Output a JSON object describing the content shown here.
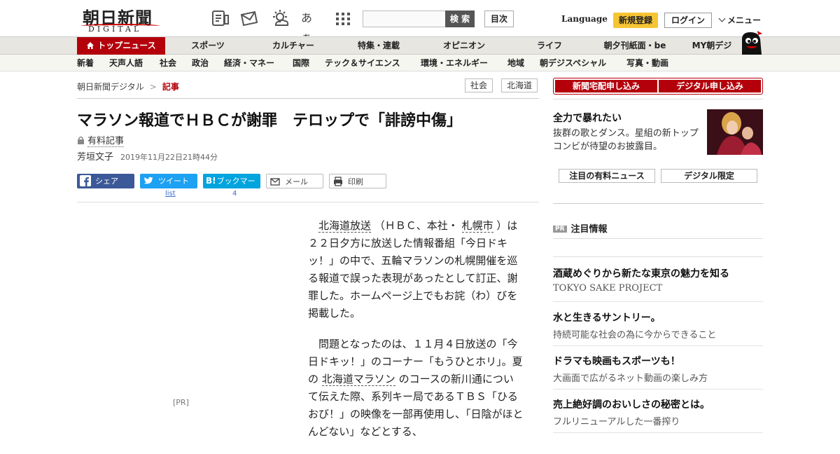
{
  "header": {
    "logo_kanji": "朝日新聞",
    "logo_sub": "DIGITAL",
    "kana_icon": "あぁ",
    "search_placeholder": "",
    "search_button": "検 索",
    "toc_button": "目次",
    "language": "Language",
    "register": "新規登録",
    "login": "ログイン",
    "menu": "メニュー"
  },
  "nav_primary": [
    "トップニュース",
    "スポーツ",
    "カルチャー",
    "特集・連載",
    "オピニオン",
    "ライフ",
    "朝夕刊紙面・be",
    "MY朝デジ"
  ],
  "nav_secondary": [
    "新着",
    "天声人語",
    "社会",
    "政治",
    "経済・マネー",
    "国際",
    "テック＆サイエンス",
    "環境・エネルギー",
    "地域",
    "朝デジスペシャル",
    "写真・動画"
  ],
  "breadcrumb": {
    "home": "朝日新聞デジタル",
    "sep": ">",
    "current": "記事"
  },
  "tags": [
    "社会",
    "北海道"
  ],
  "article": {
    "headline": "マラソン報道でＨＢＣが謝罪　テロップで「誹謗中傷」",
    "paid_label": "有料記事",
    "author": "芳垣文子",
    "date": "2019年11月22日21時44分",
    "share": {
      "facebook": "シェア",
      "twitter": "ツイート",
      "hatena": "ブックマーク",
      "mail": "メール",
      "print": "印刷"
    },
    "twitter_count": "list",
    "hatena_count": "4",
    "pr_label": "[PR]",
    "p1_link1": "北海道放送",
    "p1_mid": "（ＨＢＣ、本社・",
    "p1_link2": "札幌市",
    "p1_rest": "）は２２日夕方に放送した情報番組「今日ドキッ！」の中で、五輪マラソンの札幌開催を巡る報道で誤った表現があったとして訂正、謝罪した。ホームページ上でもお詫（わ）びを掲載した。",
    "p2_start": "問題となったのは、１１月４日放送の「今日ドキッ！」のコーナー「もうひとホリ」。夏の",
    "p2_link": "北海道マラソン",
    "p2_rest": "のコースの新川通について伝えた際、系列キー局であるＴＢＳ「ひるおび！」の映像を一部再使用し、「日陰がほとんどない」などとする、"
  },
  "sidebar": {
    "subscribe_paper": "新聞宅配申し込み",
    "subscribe_digital": "デジタル申し込み",
    "promo_title": "全力で暴れたい",
    "promo_text": "抜群の歌とダンス。星組の新トップコンビが待望のお披露目。",
    "tab_paid": "注目の有料ニュース",
    "tab_digital": "デジタル限定",
    "pr_badge": "PR",
    "pr_heading": "注目情報",
    "ads": [
      {
        "title": "酒蔵めぐりから新たな東京の魅力を知る",
        "sub": "TOKYO SAKE PROJECT"
      },
      {
        "title": "水と生きるサントリー。",
        "sub": "持続可能な社会の為に今からできること"
      },
      {
        "title": "ドラマも映画もスポーツも！",
        "sub": "大画面で広がるネット動画の楽しみ方"
      },
      {
        "title": "売上絶好調のおいしさの秘密とは。",
        "sub": "フルリニューアルした一番搾り"
      }
    ]
  },
  "colors": {
    "brand_red": "#b4000b",
    "register_yellow": "#f6c533",
    "facebook": "#3b5998",
    "twitter": "#1da1f2",
    "hatena": "#00a4de"
  }
}
